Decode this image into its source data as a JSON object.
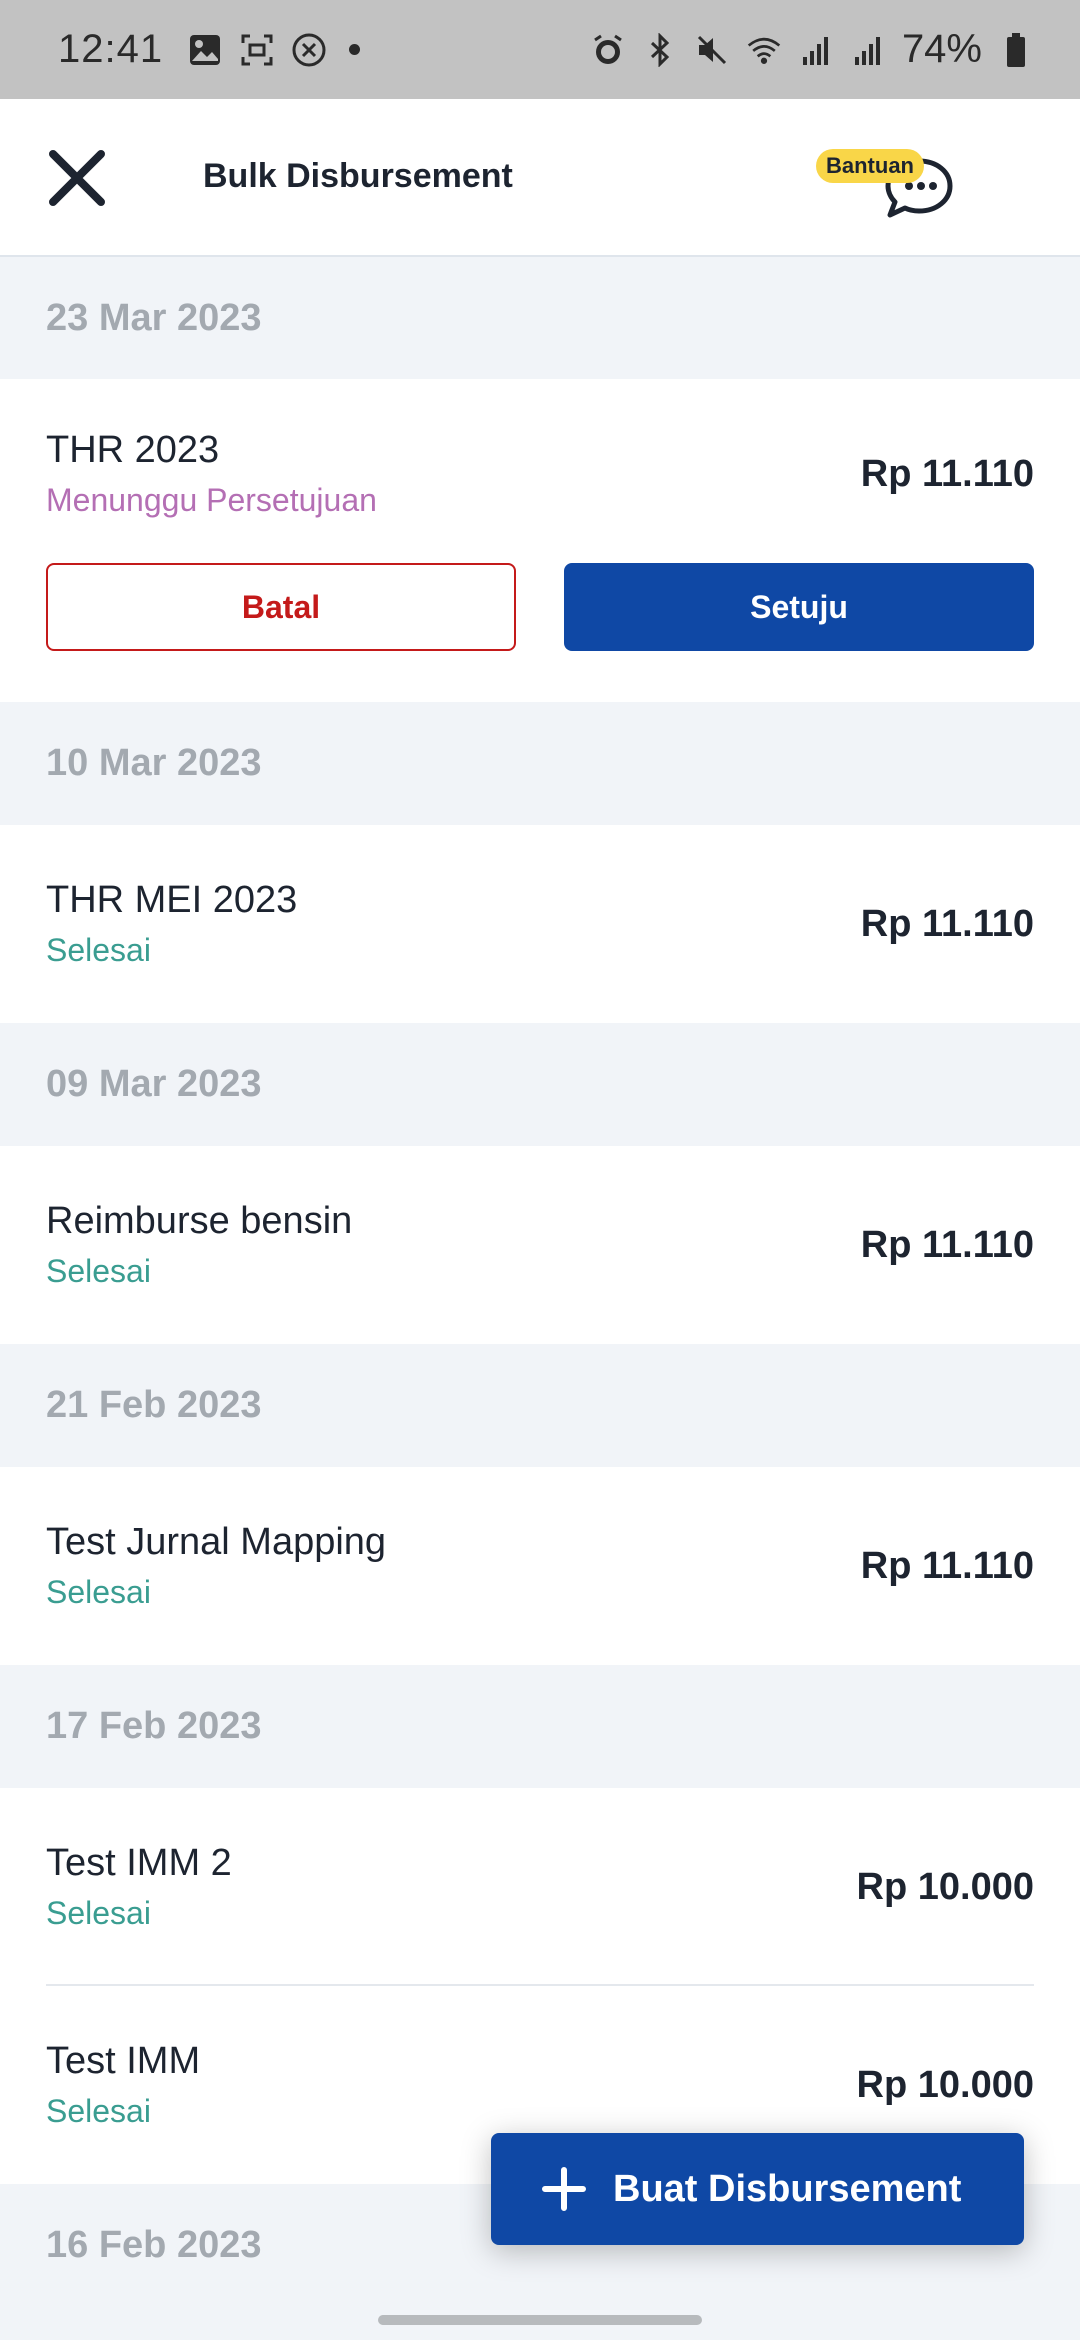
{
  "status_bar": {
    "time": "12:41",
    "battery": "74%"
  },
  "header": {
    "title": "Bulk Disbursement",
    "help_label": "Bantuan"
  },
  "groups": [
    {
      "date": "23 Mar 2023",
      "items": [
        {
          "name": "THR 2023",
          "status": "Menunggu Persetujuan",
          "amount": "Rp 11.110",
          "cancel_label": "Batal",
          "approve_label": "Setuju"
        }
      ]
    },
    {
      "date": "10 Mar 2023",
      "items": [
        {
          "name": "THR MEI 2023",
          "status": "Selesai",
          "amount": "Rp 11.110"
        }
      ]
    },
    {
      "date": "09 Mar 2023",
      "items": [
        {
          "name": "Reimburse bensin",
          "status": "Selesai",
          "amount": "Rp 11.110"
        }
      ]
    },
    {
      "date": "21 Feb 2023",
      "items": [
        {
          "name": "Test Jurnal Mapping",
          "status": "Selesai",
          "amount": "Rp 11.110"
        }
      ]
    },
    {
      "date": "17 Feb 2023",
      "items": [
        {
          "name": "Test IMM 2",
          "status": "Selesai",
          "amount": "Rp 10.000"
        },
        {
          "name": "Test IMM",
          "status": "Selesai",
          "amount": "Rp 10.000"
        }
      ]
    },
    {
      "date": "16 Feb 2023",
      "items": []
    }
  ],
  "fab": {
    "label": "Buat Disbursement"
  },
  "colors": {
    "primary": "#0f48a5",
    "danger": "#c41a1a",
    "pending": "#b46fb4",
    "done": "#3a9d91",
    "badge": "#f9d648"
  },
  "icons": {
    "close": "close-icon",
    "help": "chat-help-icon",
    "add": "plus-icon"
  }
}
